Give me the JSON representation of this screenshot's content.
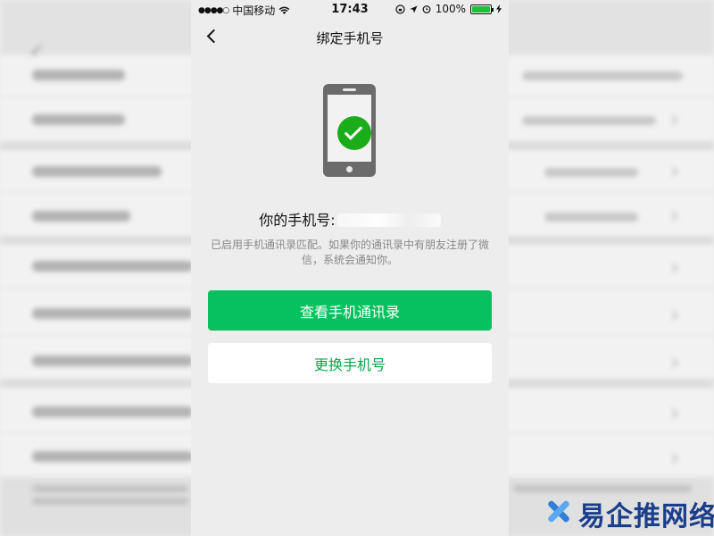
{
  "status_bar": {
    "signal": "●●●●○",
    "carrier": "中国移动",
    "wifi_icon": "wifi-icon",
    "time": "17:43",
    "battery_percent": "100%"
  },
  "nav": {
    "title": "绑定手机号",
    "back_icon": "back-chevron-icon"
  },
  "phone_info": {
    "label": "你的手机号:",
    "number_masked": true
  },
  "description": "已启用手机通讯录匹配。如果你的通讯录中有朋友注册了微信，系统会通知你。",
  "buttons": {
    "primary_label": "查看手机通讯录",
    "secondary_label": "更换手机号"
  },
  "watermark": {
    "text": "易企推网络"
  },
  "colors": {
    "accent_green": "#07c160",
    "background": "#ededed"
  }
}
